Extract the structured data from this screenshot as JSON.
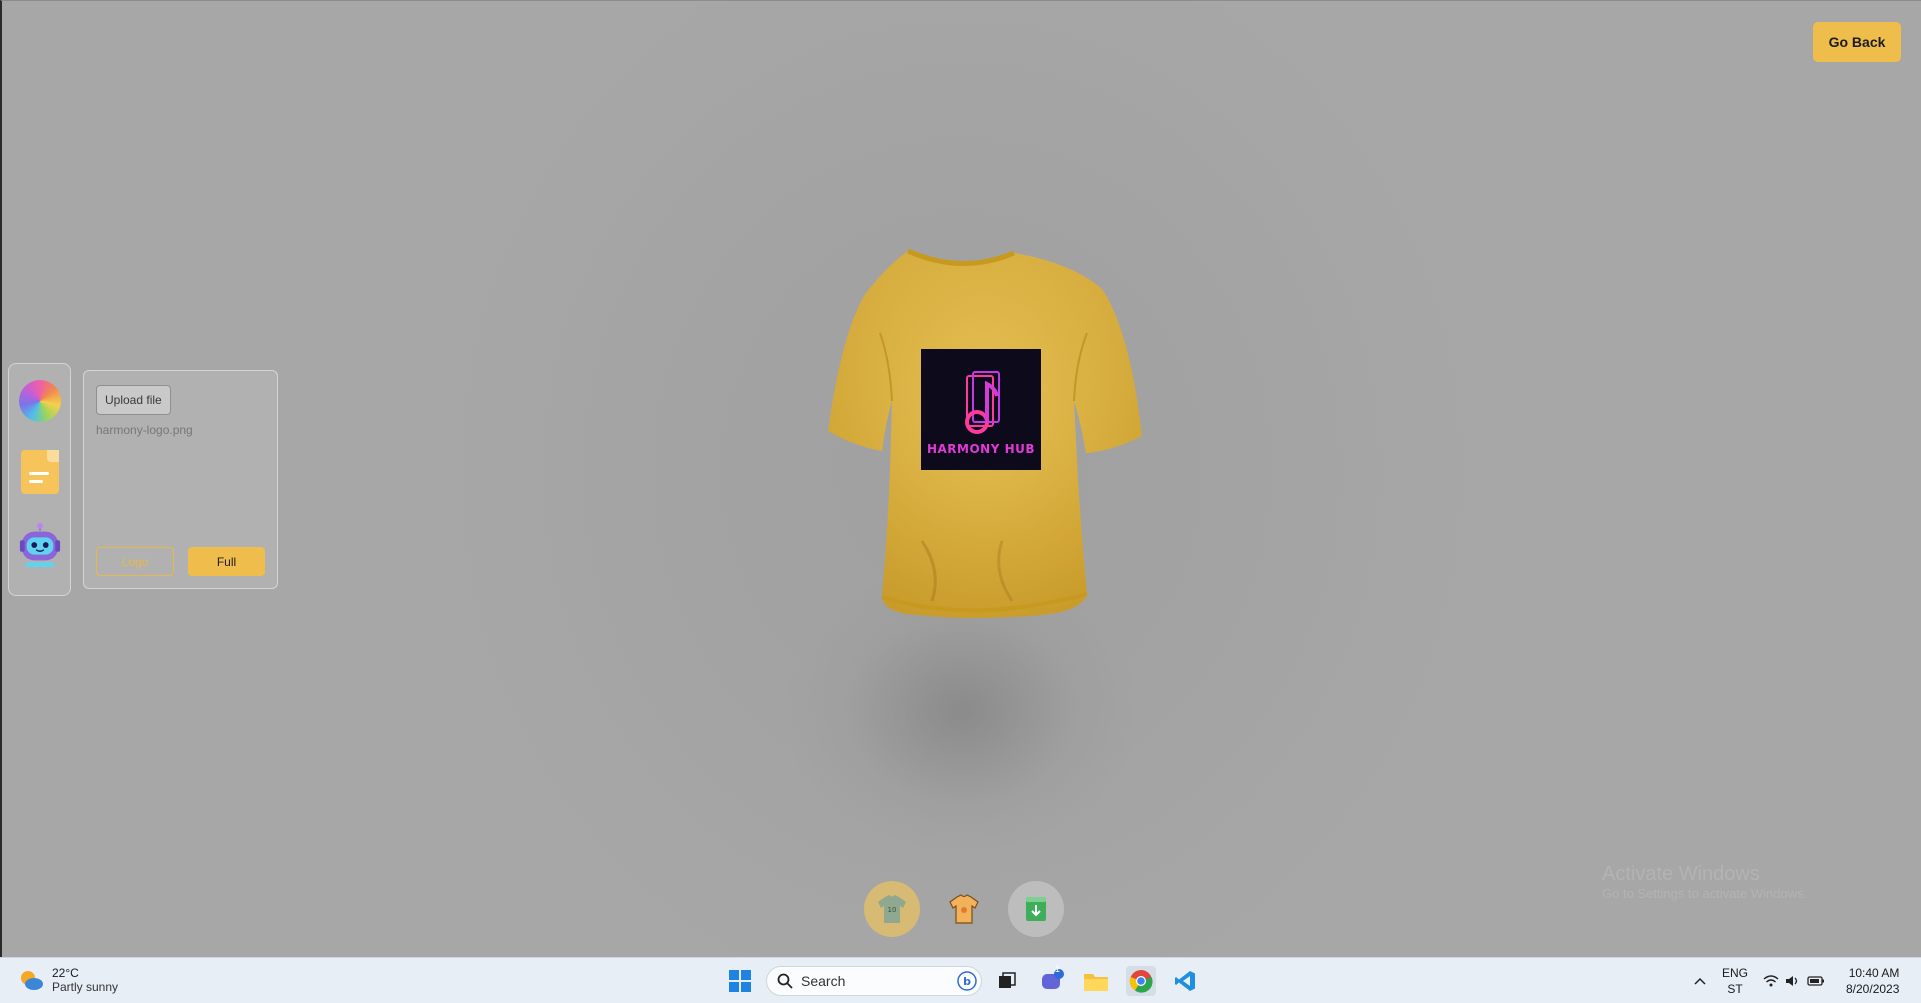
{
  "app": {
    "go_back_label": "Go Back"
  },
  "sidebar": {
    "tools": [
      {
        "icon": "color-picker-icon"
      },
      {
        "icon": "file-picker-icon"
      },
      {
        "icon": "ai-picker-icon"
      }
    ]
  },
  "file_panel": {
    "upload_label": "Upload file",
    "file_name": "harmony-logo.png",
    "logo_label": "Logo",
    "full_label": "Full"
  },
  "shirt": {
    "color": "#e2b53c",
    "decal_text": "HARMONY HUB"
  },
  "filter_bar": {
    "buttons": [
      {
        "icon": "logo-shirt-icon",
        "active": true
      },
      {
        "icon": "stylish-shirt-icon",
        "active": false
      },
      {
        "icon": "download-icon",
        "active": false
      }
    ]
  },
  "watermark": {
    "title": "Activate Windows",
    "subtitle": "Go to Settings to activate Windows."
  },
  "taskbar": {
    "weather_temp": "22°C",
    "weather_cond": "Partly sunny",
    "search_placeholder": "Search",
    "chat_badge": "1",
    "lang_top": "ENG",
    "lang_bottom": "ST",
    "time": "10:40 AM",
    "date": "8/20/2023"
  },
  "colors": {
    "accent": "#efbd4b",
    "background": "#a3a3a3"
  }
}
